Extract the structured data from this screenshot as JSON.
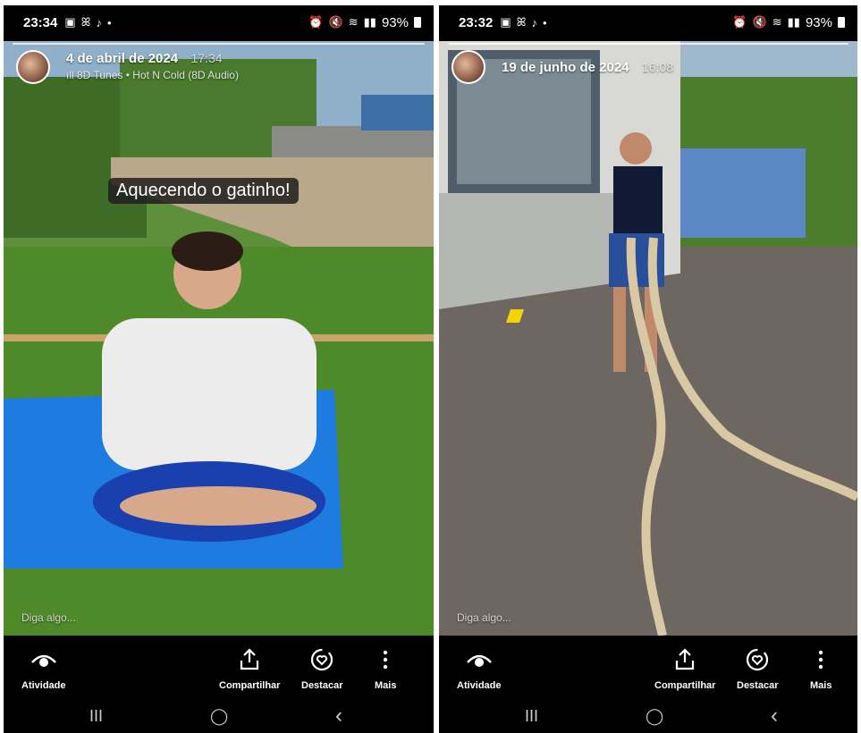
{
  "screens": [
    {
      "status": {
        "time": "23:34",
        "battery": "93%"
      },
      "story": {
        "date": "4 de abril de 2024",
        "time": "17:34",
        "music": "8D Tunes • Hot N Cold (8D Audio)",
        "caption": "Aquecendo o gatinho!",
        "reply_placeholder": "Diga algo..."
      },
      "actions": {
        "activity": "Atividade",
        "share": "Compartilhar",
        "highlight": "Destacar",
        "more": "Mais"
      },
      "nav": {
        "recents": "III",
        "home": "◯",
        "back": "‹"
      }
    },
    {
      "status": {
        "time": "23:32",
        "battery": "93%"
      },
      "story": {
        "date": "19 de junho de 2024",
        "time": "16:08",
        "reply_placeholder": "Diga algo..."
      },
      "actions": {
        "activity": "Atividade",
        "share": "Compartilhar",
        "highlight": "Destacar",
        "more": "Mais"
      },
      "nav": {
        "recents": "III",
        "home": "◯",
        "back": "‹"
      }
    }
  ],
  "icons": [
    "eye-icon",
    "share-icon",
    "highlight-heart-icon",
    "more-vertical-icon",
    "gallery-icon",
    "tiktok-icon",
    "wifi-icon",
    "signal-icon",
    "battery-icon"
  ],
  "colors": {
    "mat_blue": "#1e7be0",
    "grass_green": "#4f8a2a",
    "pavement": "#6d6661",
    "rope": "#d8c9a4",
    "ui_black": "#000000"
  }
}
